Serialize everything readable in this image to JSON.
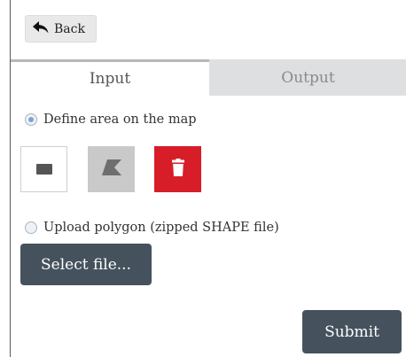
{
  "nav": {
    "back_label": "Back",
    "back_icon": "reply-arrow-icon"
  },
  "tabs": [
    {
      "label": "Input",
      "active": true
    },
    {
      "label": "Output",
      "active": false
    }
  ],
  "options": {
    "define_area_label": "Define area on the map",
    "define_area_checked": true,
    "upload_label": "Upload polygon (zipped SHAPE file)",
    "upload_checked": false
  },
  "tools": [
    {
      "name": "rectangle-draw",
      "icon": "rectangle-icon"
    },
    {
      "name": "polygon-draw",
      "icon": "polygon-icon"
    },
    {
      "name": "delete",
      "icon": "trash-icon",
      "color": "#d71e28"
    }
  ],
  "buttons": {
    "select_file": "Select file...",
    "submit": "Submit"
  },
  "colors": {
    "dark_button": "#45525e",
    "delete_red": "#d71e28",
    "radio_accent": "#7ba6cf"
  }
}
